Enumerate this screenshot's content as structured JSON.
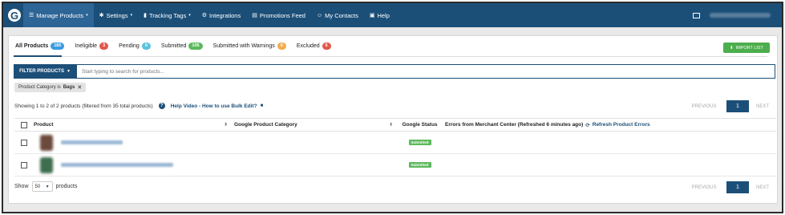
{
  "nav": {
    "items": [
      {
        "label": "Manage Products",
        "icon": "list-icon",
        "glyph": "☰",
        "caret": "▾",
        "active": true
      },
      {
        "label": "Settings",
        "icon": "gear-icon",
        "glyph": "✱",
        "caret": "▾",
        "active": false
      },
      {
        "label": "Tracking Tags",
        "icon": "bar-chart-icon",
        "glyph": "▮",
        "caret": "▾",
        "active": false
      },
      {
        "label": "Integrations",
        "icon": "puzzle-icon",
        "glyph": "⚙",
        "caret": "",
        "active": false
      },
      {
        "label": "Promotions Feed",
        "icon": "document-icon",
        "glyph": "▤",
        "caret": "",
        "active": false
      },
      {
        "label": "My Contacts",
        "icon": "people-icon",
        "glyph": "☺",
        "caret": "",
        "active": false
      },
      {
        "label": "Help",
        "icon": "chat-icon",
        "glyph": "▣",
        "caret": "",
        "active": false
      }
    ]
  },
  "tabs": [
    {
      "label": "All Products",
      "count": "185",
      "color": "blue"
    },
    {
      "label": "Ineligible",
      "count": "3",
      "color": "red"
    },
    {
      "label": "Pending",
      "count": "0",
      "color": "lightblue"
    },
    {
      "label": "Submitted",
      "count": "105",
      "color": "green"
    },
    {
      "label": "Submitted with Warnings",
      "count": "0",
      "color": "yellow"
    },
    {
      "label": "Excluded",
      "count": "6",
      "color": "red"
    }
  ],
  "import_button": {
    "label": "IMPORT LIST"
  },
  "filter": {
    "button_label": "FILTER PRODUCTS",
    "search_placeholder": "Start typing to search for products..."
  },
  "active_filter": {
    "prefix": "Product Category is",
    "value": "Bags",
    "close": "✕"
  },
  "summary": {
    "text": "Showing 1 to 2 of 2 products (filtered from 35 total products)",
    "help_link": "Help Video - How to use Bulk Edit?"
  },
  "pagination": {
    "previous": "PREVIOUS",
    "page": "1",
    "next": "NEXT"
  },
  "table": {
    "headers": {
      "product": "Product",
      "category": "Google Product Category",
      "status": "Google Status",
      "errors": "Errors from Merchant Center (Refreshed 6 minutes ago)",
      "refresh": "Refresh Product Errors"
    },
    "rows": [
      {
        "status": "Submitted",
        "thumb_color": "brown",
        "name_width_pct": 55
      },
      {
        "status": "Submitted",
        "thumb_color": "green",
        "name_width_pct": 100
      }
    ]
  },
  "footer": {
    "show_label": "Show",
    "page_size": "50",
    "suffix": "products"
  }
}
